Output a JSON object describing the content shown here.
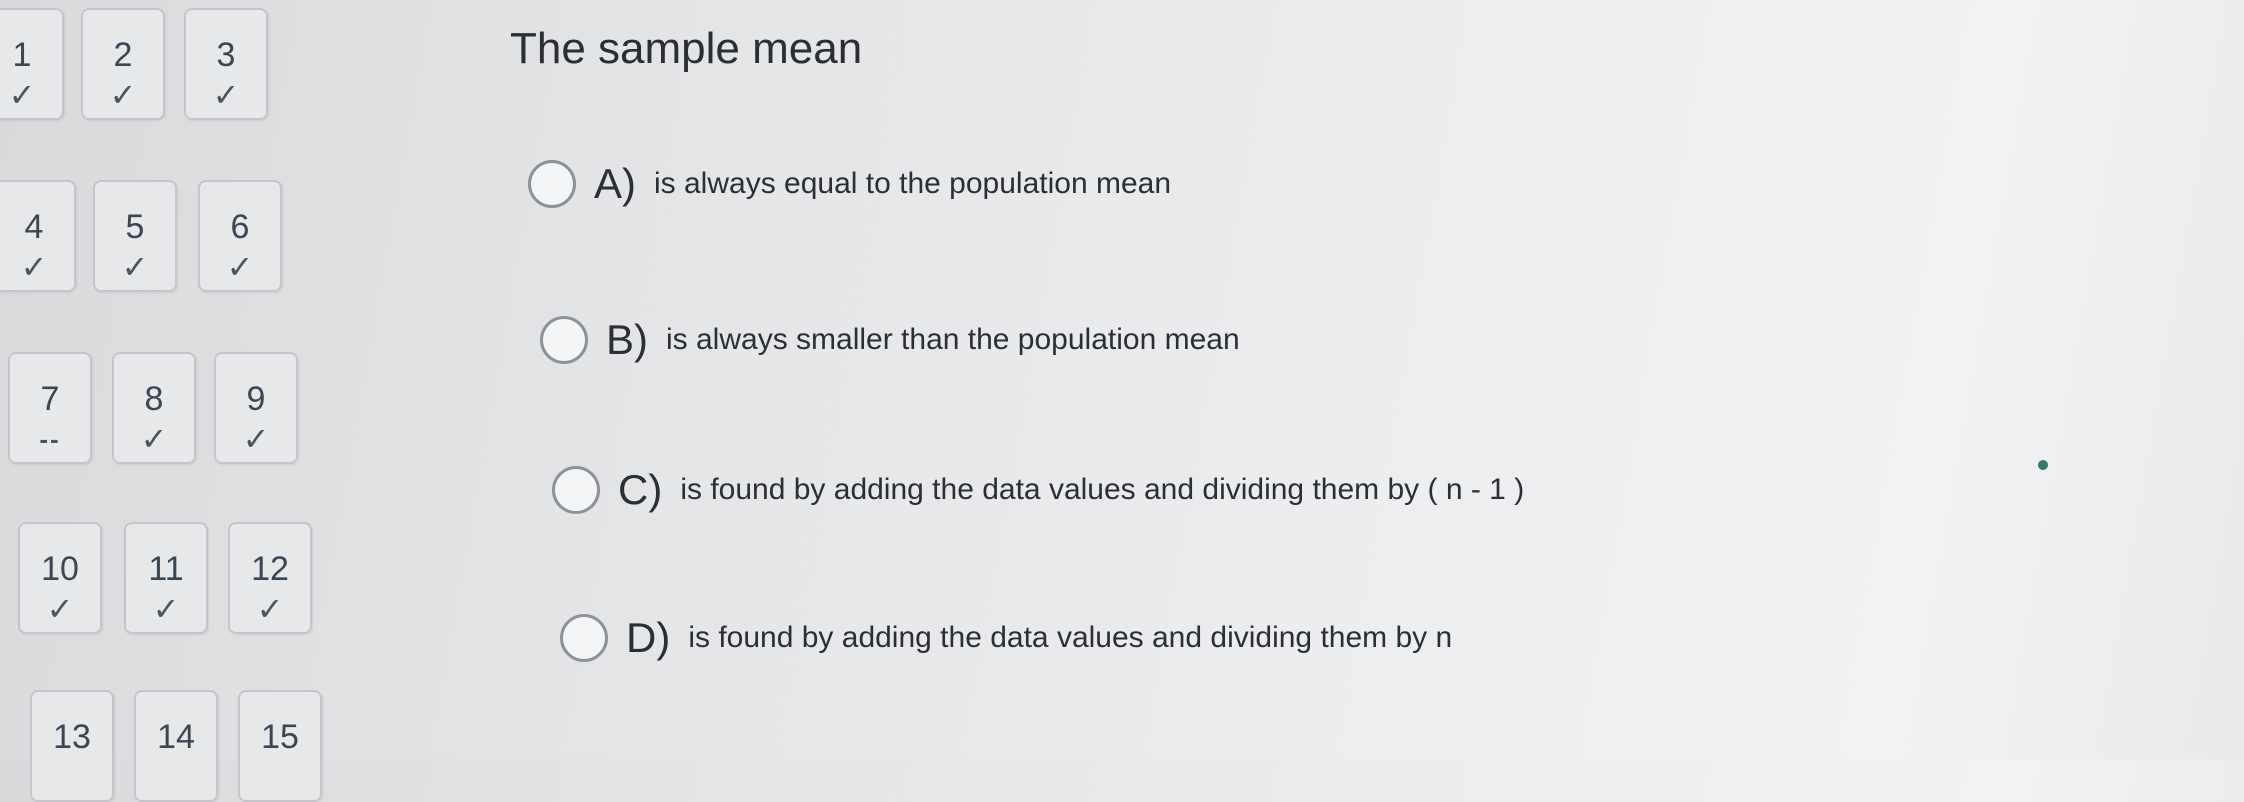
{
  "nav": {
    "tiles": [
      {
        "num": "1",
        "mark": "✓"
      },
      {
        "num": "2",
        "mark": "✓"
      },
      {
        "num": "3",
        "mark": "✓"
      },
      {
        "num": "4",
        "mark": "✓"
      },
      {
        "num": "5",
        "mark": "✓"
      },
      {
        "num": "6",
        "mark": "✓"
      },
      {
        "num": "7",
        "mark": "--"
      },
      {
        "num": "8",
        "mark": "✓"
      },
      {
        "num": "9",
        "mark": "✓"
      },
      {
        "num": "10",
        "mark": "✓"
      },
      {
        "num": "11",
        "mark": "✓"
      },
      {
        "num": "12",
        "mark": "✓"
      },
      {
        "num": "13",
        "mark": ""
      },
      {
        "num": "14",
        "mark": ""
      },
      {
        "num": "15",
        "mark": ""
      }
    ]
  },
  "question": {
    "title": "The sample mean",
    "options": [
      {
        "letter": "A)",
        "text": "is always equal to the population mean"
      },
      {
        "letter": "B)",
        "text": "is always smaller than the population mean"
      },
      {
        "letter": "C)",
        "text": "is found by adding the data values and dividing them by ( n - 1 )"
      },
      {
        "letter": "D)",
        "text": "is found by adding the data values and dividing them by n"
      }
    ]
  },
  "colors": {
    "tile_border": "#c4c6c9",
    "text": "#2b2f33",
    "radio_border": "#8e9297"
  }
}
